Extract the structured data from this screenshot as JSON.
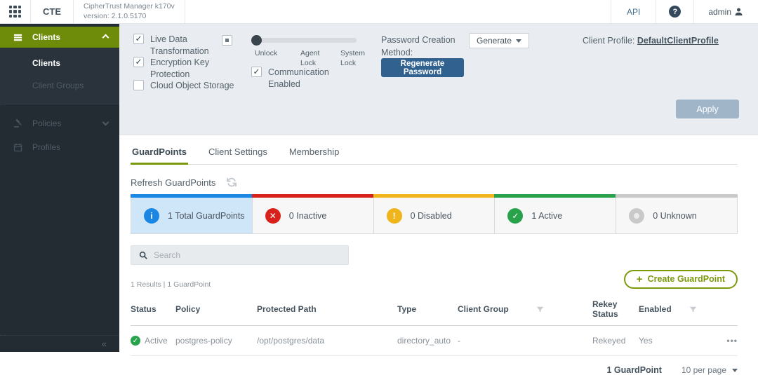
{
  "topbar": {
    "brand": "CTE",
    "product_name": "CipherTrust Manager k170v",
    "product_version": "version: 2.1.0.5170",
    "api_label": "API",
    "help_glyph": "?",
    "username": "admin"
  },
  "sidebar": {
    "section_label": "Clients",
    "items": [
      {
        "label": "Clients",
        "active": true
      },
      {
        "label": "Client Groups",
        "active": false
      },
      {
        "label": "Policies",
        "active": false
      },
      {
        "label": "Profiles",
        "active": false
      }
    ],
    "collapse_glyph": "«"
  },
  "panel": {
    "checkboxes": [
      {
        "label": "Live Data Transformation",
        "checked": true
      },
      {
        "label": "Encryption Key Protection",
        "checked": true
      },
      {
        "label": "Cloud Object Storage",
        "checked": false
      }
    ],
    "check_glyph": "✓",
    "slider": {
      "labels": [
        "Unlock",
        "Agent Lock",
        "System Lock"
      ],
      "value": "Unlock"
    },
    "communication_label": "Communication Enabled",
    "communication_checked": true,
    "password_label": "Password Creation Method:",
    "password_method": "Generate",
    "regenerate_label": "Regenerate Password",
    "client_profile_label": "Client Profile:",
    "client_profile_link": "DefaultClientProfile",
    "apply_label": "Apply"
  },
  "tabs": {
    "items": [
      {
        "label": "GuardPoints",
        "active": true
      },
      {
        "label": "Client Settings",
        "active": false
      },
      {
        "label": "Membership",
        "active": false
      }
    ]
  },
  "guardpoints": {
    "refresh_label": "Refresh GuardPoints",
    "cards": [
      {
        "label": "1 Total GuardPoints",
        "accent": "#1b87e5",
        "glyph": "i",
        "selected": true
      },
      {
        "label": "0 Inactive",
        "accent": "#d7221c",
        "glyph": "✕",
        "selected": false
      },
      {
        "label": "0 Disabled",
        "accent": "#f0b41c",
        "glyph": "!",
        "selected": false
      },
      {
        "label": "1 Active",
        "accent": "#28a34c",
        "glyph": "✓",
        "selected": false
      },
      {
        "label": "0 Unknown",
        "accent": "#c9c9c9",
        "glyph": "",
        "selected": false
      }
    ],
    "search_placeholder": "Search",
    "results_text": "1 Results | 1 GuardPoint",
    "create_plus": "+",
    "create_label": "Create GuardPoint",
    "table": {
      "columns": [
        "Status",
        "Policy",
        "Protected Path",
        "Type",
        "Client Group",
        "Rekey Status",
        "Enabled"
      ],
      "row": {
        "status": "Active",
        "status_glyph": "✓",
        "policy": "postgres-policy",
        "protected_path": "/opt/postgres/data",
        "type": "directory_auto",
        "client_group": "-",
        "rekey_status": "Rekeyed",
        "enabled": "Yes"
      },
      "actions_glyph": "•••"
    },
    "footer": {
      "count_label": "1 GuardPoint",
      "per_page_label": "10 per page"
    }
  }
}
